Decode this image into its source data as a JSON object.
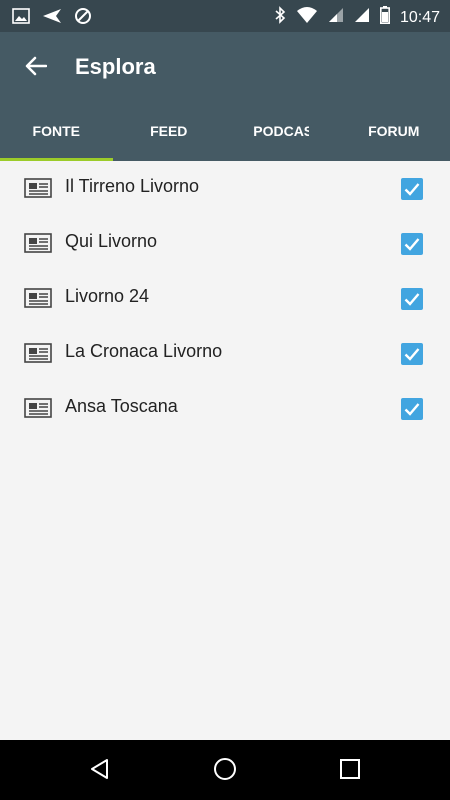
{
  "status_bar": {
    "time": "10:47",
    "left_icons": [
      "image-icon",
      "send-icon",
      "block-icon"
    ],
    "right_icons": [
      "bluetooth-icon",
      "wifi-icon",
      "signal-icon",
      "signal-icon",
      "battery-icon"
    ]
  },
  "app_bar": {
    "title": "Esplora",
    "back_icon": "arrow-back-icon"
  },
  "tabs": [
    {
      "label": "FONTE",
      "active": true
    },
    {
      "label": "FEED",
      "active": false
    },
    {
      "label": "PODCAST",
      "active": false
    },
    {
      "label": "FORUM",
      "active": false
    }
  ],
  "sources": [
    {
      "name": "Il Tirreno Livorno",
      "checked": true
    },
    {
      "name": "Qui Livorno",
      "checked": true
    },
    {
      "name": "Livorno 24",
      "checked": true
    },
    {
      "name": "La Cronaca Livorno",
      "checked": true
    },
    {
      "name": "Ansa Toscana",
      "checked": true
    }
  ],
  "colors": {
    "appbar": "#455a64",
    "statusbar": "#37474f",
    "tab_indicator": "#9ccc2a",
    "checkbox": "#42a5e0"
  },
  "nav_bar": {
    "icons": [
      "back-triangle-icon",
      "home-circle-icon",
      "recents-square-icon"
    ]
  }
}
